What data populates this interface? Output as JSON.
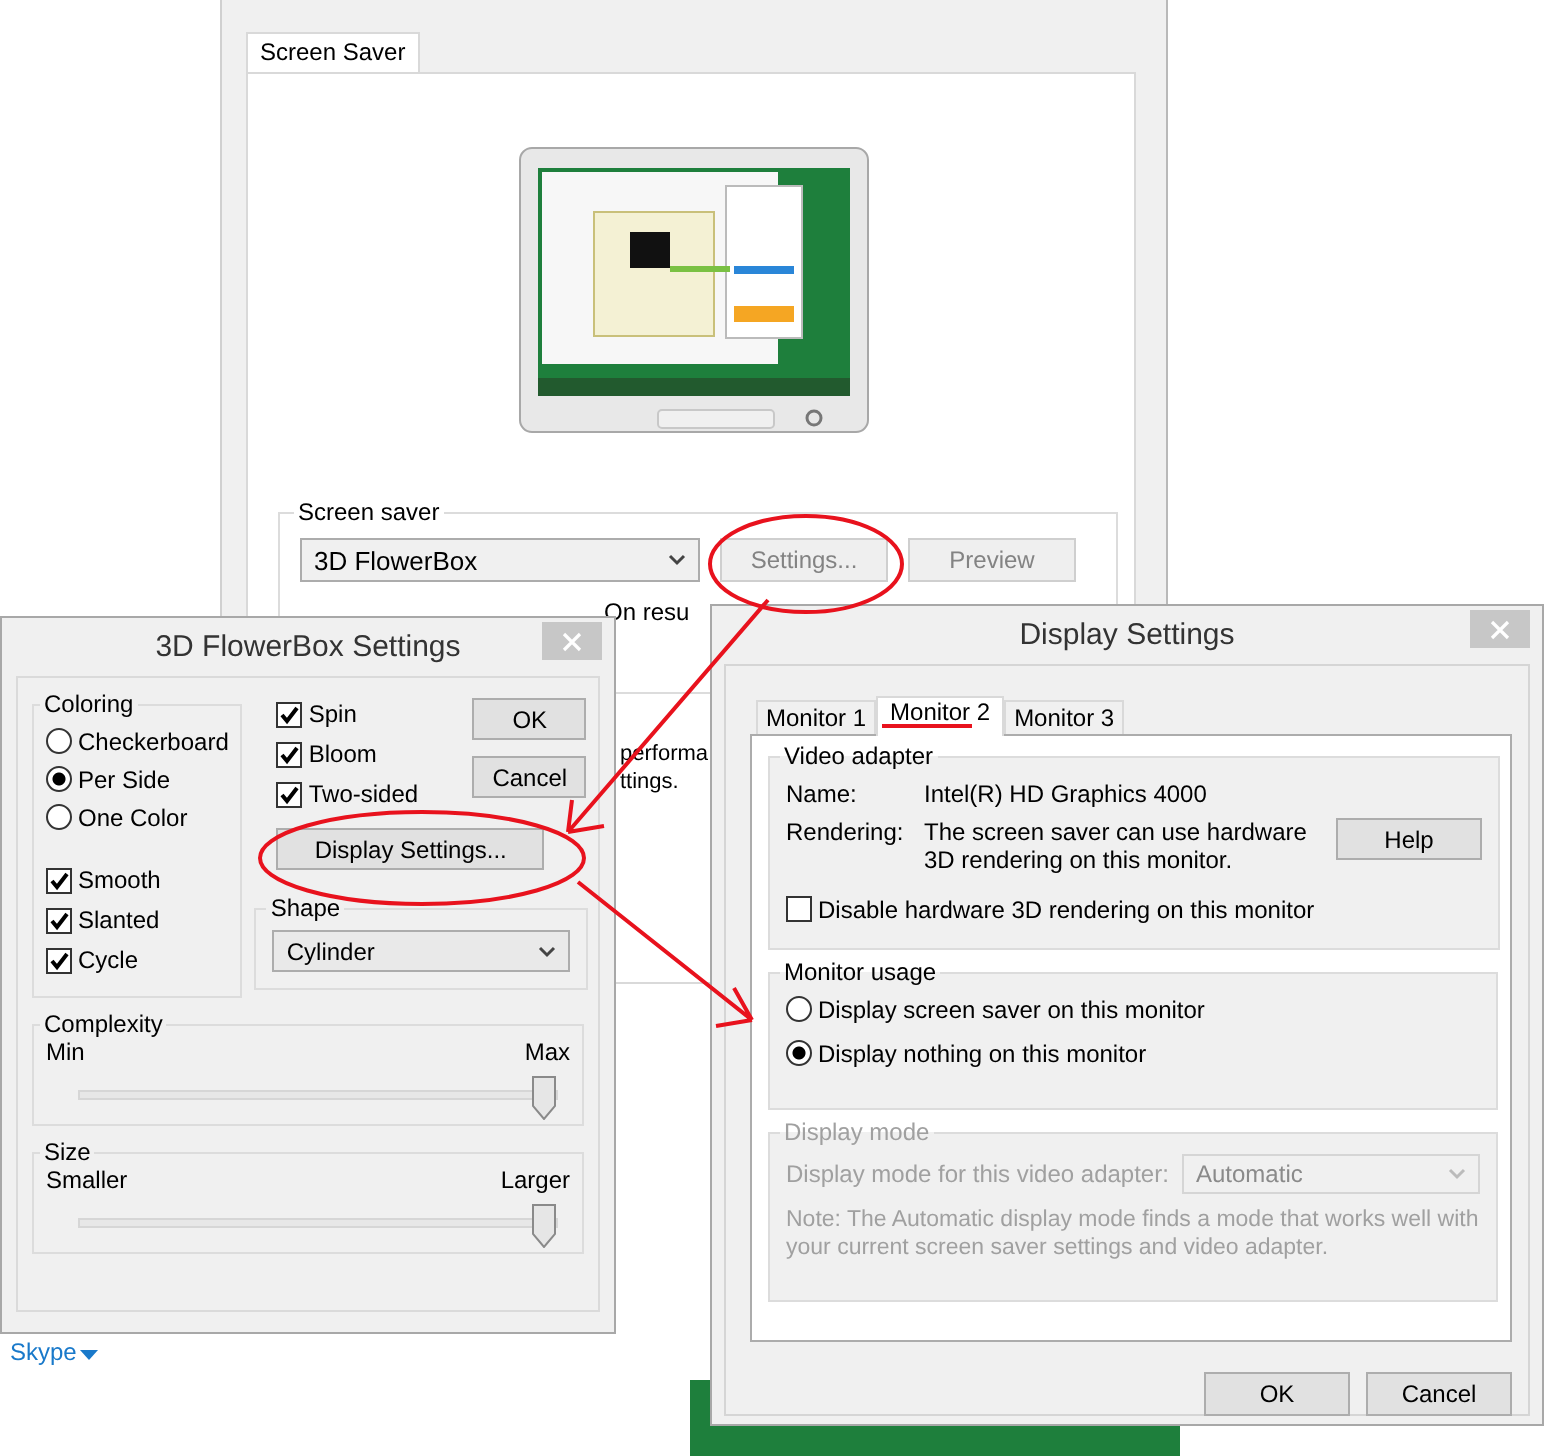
{
  "screen_saver_window": {
    "tabs": [
      {
        "label": "Screen Saver",
        "selected": true
      }
    ],
    "screen_saver_group": {
      "label": "Screen saver",
      "selection": "3D FlowerBox",
      "buttons": [
        {
          "label": "Settings...",
          "disabled": true
        },
        {
          "label": "Preview",
          "disabled": true
        }
      ],
      "resume_text": "On resu"
    },
    "description_fragments": [
      "performa",
      "ttings."
    ]
  },
  "desktop": {
    "link": "Skype"
  },
  "flowerbox_settings": {
    "title": "3D FlowerBox Settings",
    "coloring": {
      "label": "Coloring",
      "options": [
        {
          "label": "Checkerboard",
          "selected": false
        },
        {
          "label": "Per Side",
          "selected": true
        },
        {
          "label": "One Color",
          "selected": false
        }
      ],
      "checkboxes": [
        {
          "label": "Smooth",
          "checked": true
        },
        {
          "label": "Slanted",
          "checked": true
        },
        {
          "label": "Cycle",
          "checked": true
        }
      ]
    },
    "checkboxes": [
      {
        "label": "Spin",
        "checked": true
      },
      {
        "label": "Bloom",
        "checked": true
      },
      {
        "label": "Two-sided",
        "checked": true
      }
    ],
    "buttons": [
      "OK",
      "Cancel"
    ],
    "display_settings_button": "Display Settings...",
    "shape": {
      "label": "Shape",
      "value": "Cylinder"
    },
    "sliders": [
      {
        "label": "Complexity",
        "min_label": "Min",
        "max_label": "Max",
        "level": 1
      },
      {
        "label": "Size",
        "min_label": "Smaller",
        "max_label": "Larger",
        "level": 1
      }
    ]
  },
  "display_settings": {
    "title": "Display Settings",
    "tabs": [
      {
        "label": "Monitor 1",
        "selected": false
      },
      {
        "label": "Monitor 2",
        "selected": true
      },
      {
        "label": "Monitor 3",
        "selected": false
      }
    ],
    "video_adapter": {
      "label": "Video adapter",
      "rows": [
        {
          "label": "Name:",
          "value": "Intel(R) HD Graphics 4000"
        },
        {
          "label": "Rendering:",
          "value": "The screen saver can use hardware 3D rendering on this monitor."
        }
      ],
      "help_button": "Help",
      "checkbox": {
        "label": "Disable hardware 3D rendering on this monitor",
        "checked": false
      }
    },
    "monitor_usage": {
      "label": "Monitor usage",
      "options": [
        {
          "label": "Display screen saver on this monitor",
          "selected": false
        },
        {
          "label": "Display nothing on this monitor",
          "selected": true
        }
      ]
    },
    "display_mode": {
      "label": "Display mode",
      "disabled": true,
      "field_label": "Display mode for this video adapter:",
      "value": "Automatic",
      "note": "Note: The Automatic display mode finds a mode that works well with your current screen saver settings and video adapter."
    },
    "buttons": [
      "OK",
      "Cancel"
    ]
  }
}
